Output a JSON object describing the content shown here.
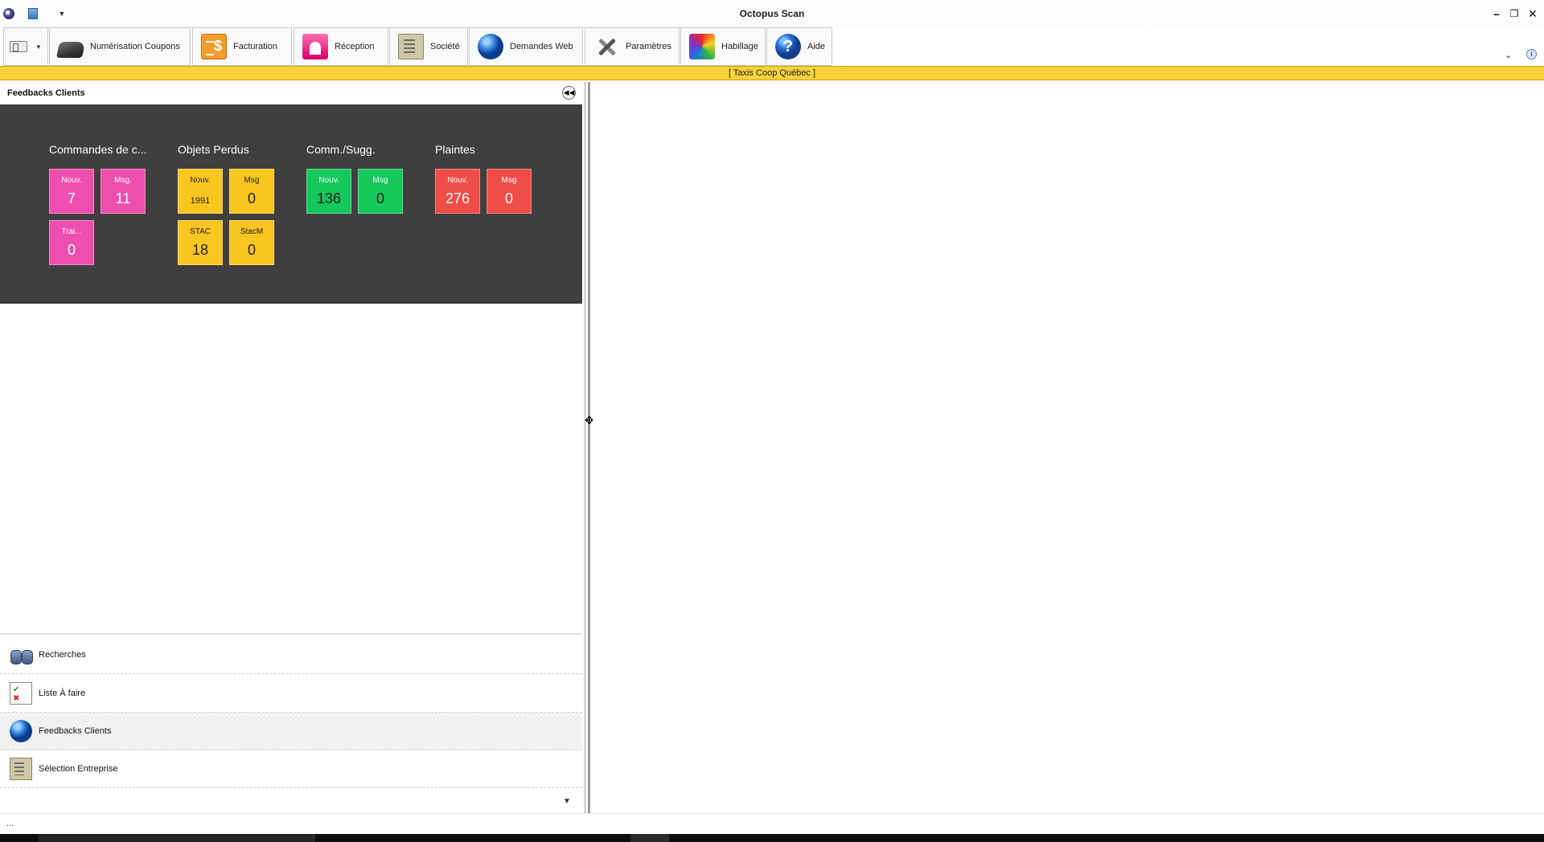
{
  "window": {
    "title": "Octopus Scan",
    "controls": {
      "minimize": "–",
      "restore": "❐",
      "close": "✕"
    }
  },
  "ribbon": {
    "tabs": [
      {
        "label": "Numérisation Coupons",
        "icon": "scanner-icon"
      },
      {
        "label": "Facturation",
        "icon": "invoice-icon"
      },
      {
        "label": "Réception",
        "icon": "reception-icon"
      },
      {
        "label": "Société",
        "icon": "company-icon"
      },
      {
        "label": "Demandes Web",
        "icon": "globe-icon"
      },
      {
        "label": "Paramètres",
        "icon": "tools-icon"
      },
      {
        "label": "Habillage",
        "icon": "palette-icon"
      },
      {
        "label": "Aide",
        "icon": "help-icon"
      }
    ]
  },
  "company_bar": {
    "text": "[   Taxis Coop Québec   ]"
  },
  "left_panel": {
    "title": "Feedbacks Clients",
    "groups": [
      {
        "title": "Commandes de c...",
        "color": "#ee4fae",
        "tiles": [
          {
            "label": "Nouv.",
            "value": "7"
          },
          {
            "label": "Msg.",
            "value": "11"
          },
          {
            "label": "Trai...",
            "value": "0"
          }
        ]
      },
      {
        "title": "Objets Perdus",
        "color": "#f9c51f",
        "tiles": [
          {
            "label": "Nouv.",
            "value": "1991"
          },
          {
            "label": "Msg",
            "value": "0"
          },
          {
            "label": "STAC",
            "value": "18"
          },
          {
            "label": "StacM",
            "value": "0"
          }
        ]
      },
      {
        "title": "Comm./Sugg.",
        "color": "#14c85a",
        "tiles": [
          {
            "label": "Nouv.",
            "value": "136"
          },
          {
            "label": "Msg",
            "value": "0"
          }
        ]
      },
      {
        "title": "Plaintes",
        "color": "#f04c48",
        "tiles": [
          {
            "label": "Nouv.",
            "value": "276"
          },
          {
            "label": "Msg",
            "value": "0"
          }
        ]
      }
    ],
    "nav_items": [
      {
        "label": "Recherches",
        "icon": "binoculars-icon",
        "active": false
      },
      {
        "label": "Liste À faire",
        "icon": "todo-list-icon",
        "active": false
      },
      {
        "label": "Feedbacks Clients",
        "icon": "globe-icon",
        "active": true
      },
      {
        "label": "Sélection Entreprise",
        "icon": "company-icon",
        "active": false
      }
    ]
  },
  "status_bar": {
    "text": "..."
  }
}
